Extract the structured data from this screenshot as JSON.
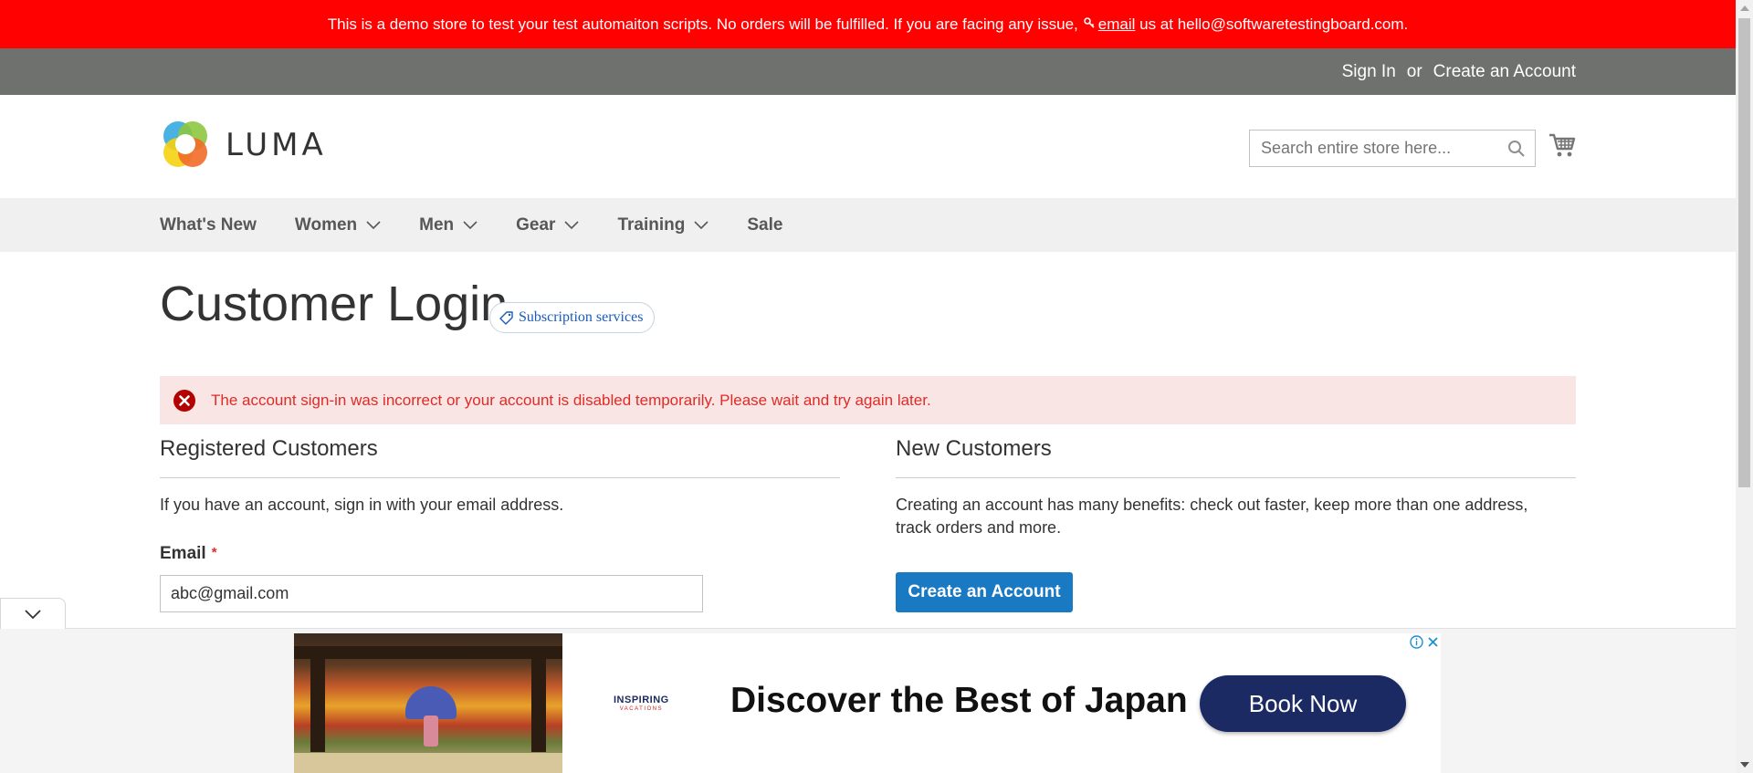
{
  "notice": {
    "text_before": "This is a demo store to test your test automaiton scripts. No orders will be fulfilled. If you are facing any issue,",
    "key_icon": "key-icon",
    "email_link": "email",
    "text_after": " us at hello@softwaretestingboard.com."
  },
  "top_links": {
    "sign_in": "Sign In",
    "or": "or",
    "create_account": "Create an Account"
  },
  "header": {
    "logo_text": "LUMA",
    "search_placeholder": "Search entire store here...",
    "search_icon": "search-icon",
    "cart_icon": "cart-icon"
  },
  "nav": {
    "items": [
      {
        "label": "What's New",
        "has_dropdown": false
      },
      {
        "label": "Women",
        "has_dropdown": true
      },
      {
        "label": "Men",
        "has_dropdown": true
      },
      {
        "label": "Gear",
        "has_dropdown": true
      },
      {
        "label": "Training",
        "has_dropdown": true
      },
      {
        "label": "Sale",
        "has_dropdown": false
      }
    ]
  },
  "page": {
    "title": "Customer Login",
    "badge": "Subscription services"
  },
  "error": {
    "message": "The account sign-in was incorrect or your account is disabled temporarily. Please wait and try again later."
  },
  "registered": {
    "title": "Registered Customers",
    "text": "If you have an account, sign in with your email address.",
    "email_label": "Email",
    "required_mark": "*",
    "email_value": "abc@gmail.com"
  },
  "new_customers": {
    "title": "New Customers",
    "text": "Creating an account has many benefits: check out faster, keep more than one address, track orders and more.",
    "button": "Create an Account"
  },
  "ad": {
    "brand": "INSPIRING",
    "brand_sub": "VACATIONS",
    "headline": "Discover the Best of Japan",
    "cta": "Book Now"
  },
  "colors": {
    "notice_bg": "#ff0101",
    "top_panel_bg": "#6e716e",
    "nav_bg": "#f0f0f0",
    "error_bg": "#fae5e5",
    "error_text": "#e02b27",
    "primary_button": "#1979c3",
    "ad_cta": "#1b2a63"
  }
}
